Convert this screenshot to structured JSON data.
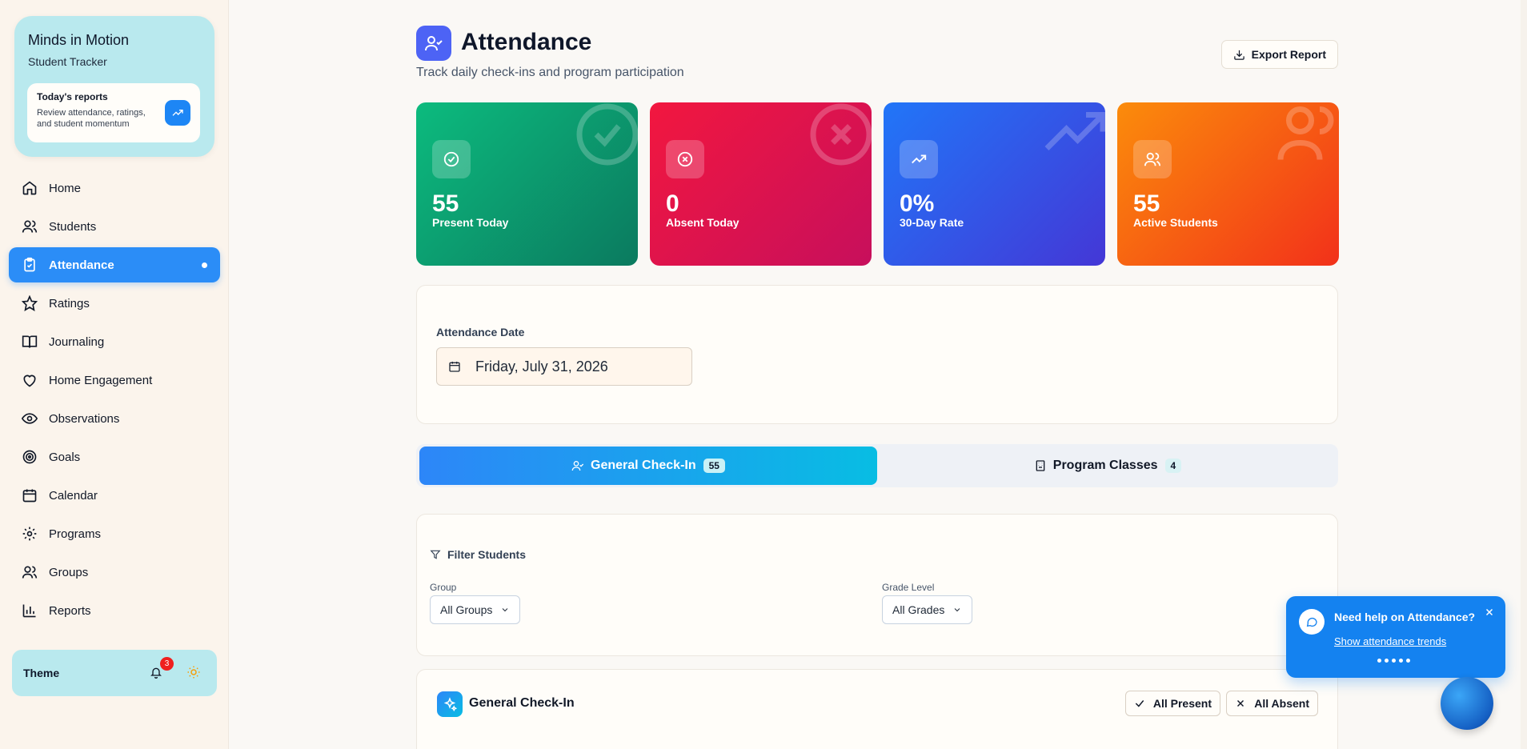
{
  "brand": {
    "title": "Minds in Motion",
    "subtitle": "Student Tracker",
    "report_title": "Today's reports",
    "report_desc": "Review attendance, ratings, and student momentum"
  },
  "nav": [
    {
      "label": "Home",
      "icon": "home-icon"
    },
    {
      "label": "Students",
      "icon": "users-icon"
    },
    {
      "label": "Attendance",
      "icon": "clipboard-check-icon",
      "active": true
    },
    {
      "label": "Ratings",
      "icon": "star-icon"
    },
    {
      "label": "Journaling",
      "icon": "book-icon"
    },
    {
      "label": "Home Engagement",
      "icon": "heart-icon"
    },
    {
      "label": "Observations",
      "icon": "eye-icon"
    },
    {
      "label": "Goals",
      "icon": "target-icon"
    },
    {
      "label": "Calendar",
      "icon": "calendar-icon"
    },
    {
      "label": "Programs",
      "icon": "gear-icon"
    },
    {
      "label": "Groups",
      "icon": "users-icon"
    },
    {
      "label": "Reports",
      "icon": "bar-chart-icon"
    }
  ],
  "theme": {
    "label": "Theme",
    "notifications": "3"
  },
  "header": {
    "title": "Attendance",
    "subtitle": "Track daily check-ins and program participation",
    "export_label": "Export Report"
  },
  "stats": [
    {
      "value": "55",
      "label": "Present Today",
      "color_from": "#0cbb7e",
      "color_to": "#0b7a5f"
    },
    {
      "value": "0",
      "label": "Absent Today",
      "color_from": "#f2173f",
      "color_to": "#c70f5c"
    },
    {
      "value": "0%",
      "label": "30-Day Rate",
      "color_from": "#2176f8",
      "color_to": "#4437d6"
    },
    {
      "value": "55",
      "label": "Active Students",
      "color_from": "#fb8c0b",
      "color_to": "#f2311a"
    }
  ],
  "date": {
    "label": "Attendance Date",
    "value": "Friday, July 31, 2026"
  },
  "tabs": [
    {
      "label": "General Check-In",
      "count": "55"
    },
    {
      "label": "Program Classes",
      "count": "4"
    }
  ],
  "filters": {
    "title": "Filter Students",
    "group_label": "Group",
    "group_value": "All Groups",
    "grade_label": "Grade Level",
    "grade_value": "All Grades"
  },
  "checkin": {
    "title": "General Check-In",
    "all_present": "All Present",
    "all_absent": "All Absent"
  },
  "help": {
    "title": "Need help on Attendance?",
    "link": "Show attendance trends"
  }
}
